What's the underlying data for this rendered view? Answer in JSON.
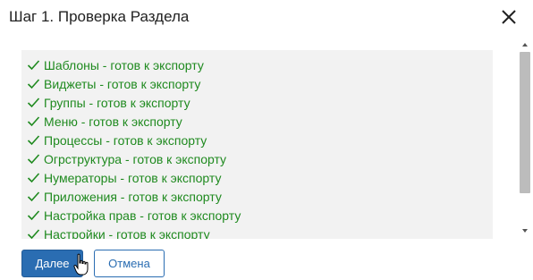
{
  "dialog": {
    "title": "Шаг 1. Проверка Раздела",
    "close_icon": "close-icon"
  },
  "check_list": {
    "items": [
      {
        "label": "Шаблоны - готов к экспорту",
        "status": "ok"
      },
      {
        "label": "Виджеты - готов к экспорту",
        "status": "ok"
      },
      {
        "label": "Группы - готов к экспорту",
        "status": "ok"
      },
      {
        "label": "Меню - готов к экспорту",
        "status": "ok"
      },
      {
        "label": "Процессы - готов к экспорту",
        "status": "ok"
      },
      {
        "label": "Огрструктура - готов к экспорту",
        "status": "ok"
      },
      {
        "label": "Нумераторы - готов к экспорту",
        "status": "ok"
      },
      {
        "label": "Приложения - готов к экспорту",
        "status": "ok"
      },
      {
        "label": "Настройка прав - готов к экспорту",
        "status": "ok"
      },
      {
        "label": "Настройки - готов к экспорту",
        "status": "ok"
      }
    ],
    "item_color": "#1f8a1f",
    "icon": "check-icon"
  },
  "buttons": {
    "next_label": "Далее",
    "cancel_label": "Отмена",
    "primary_color": "#2a6db2"
  }
}
